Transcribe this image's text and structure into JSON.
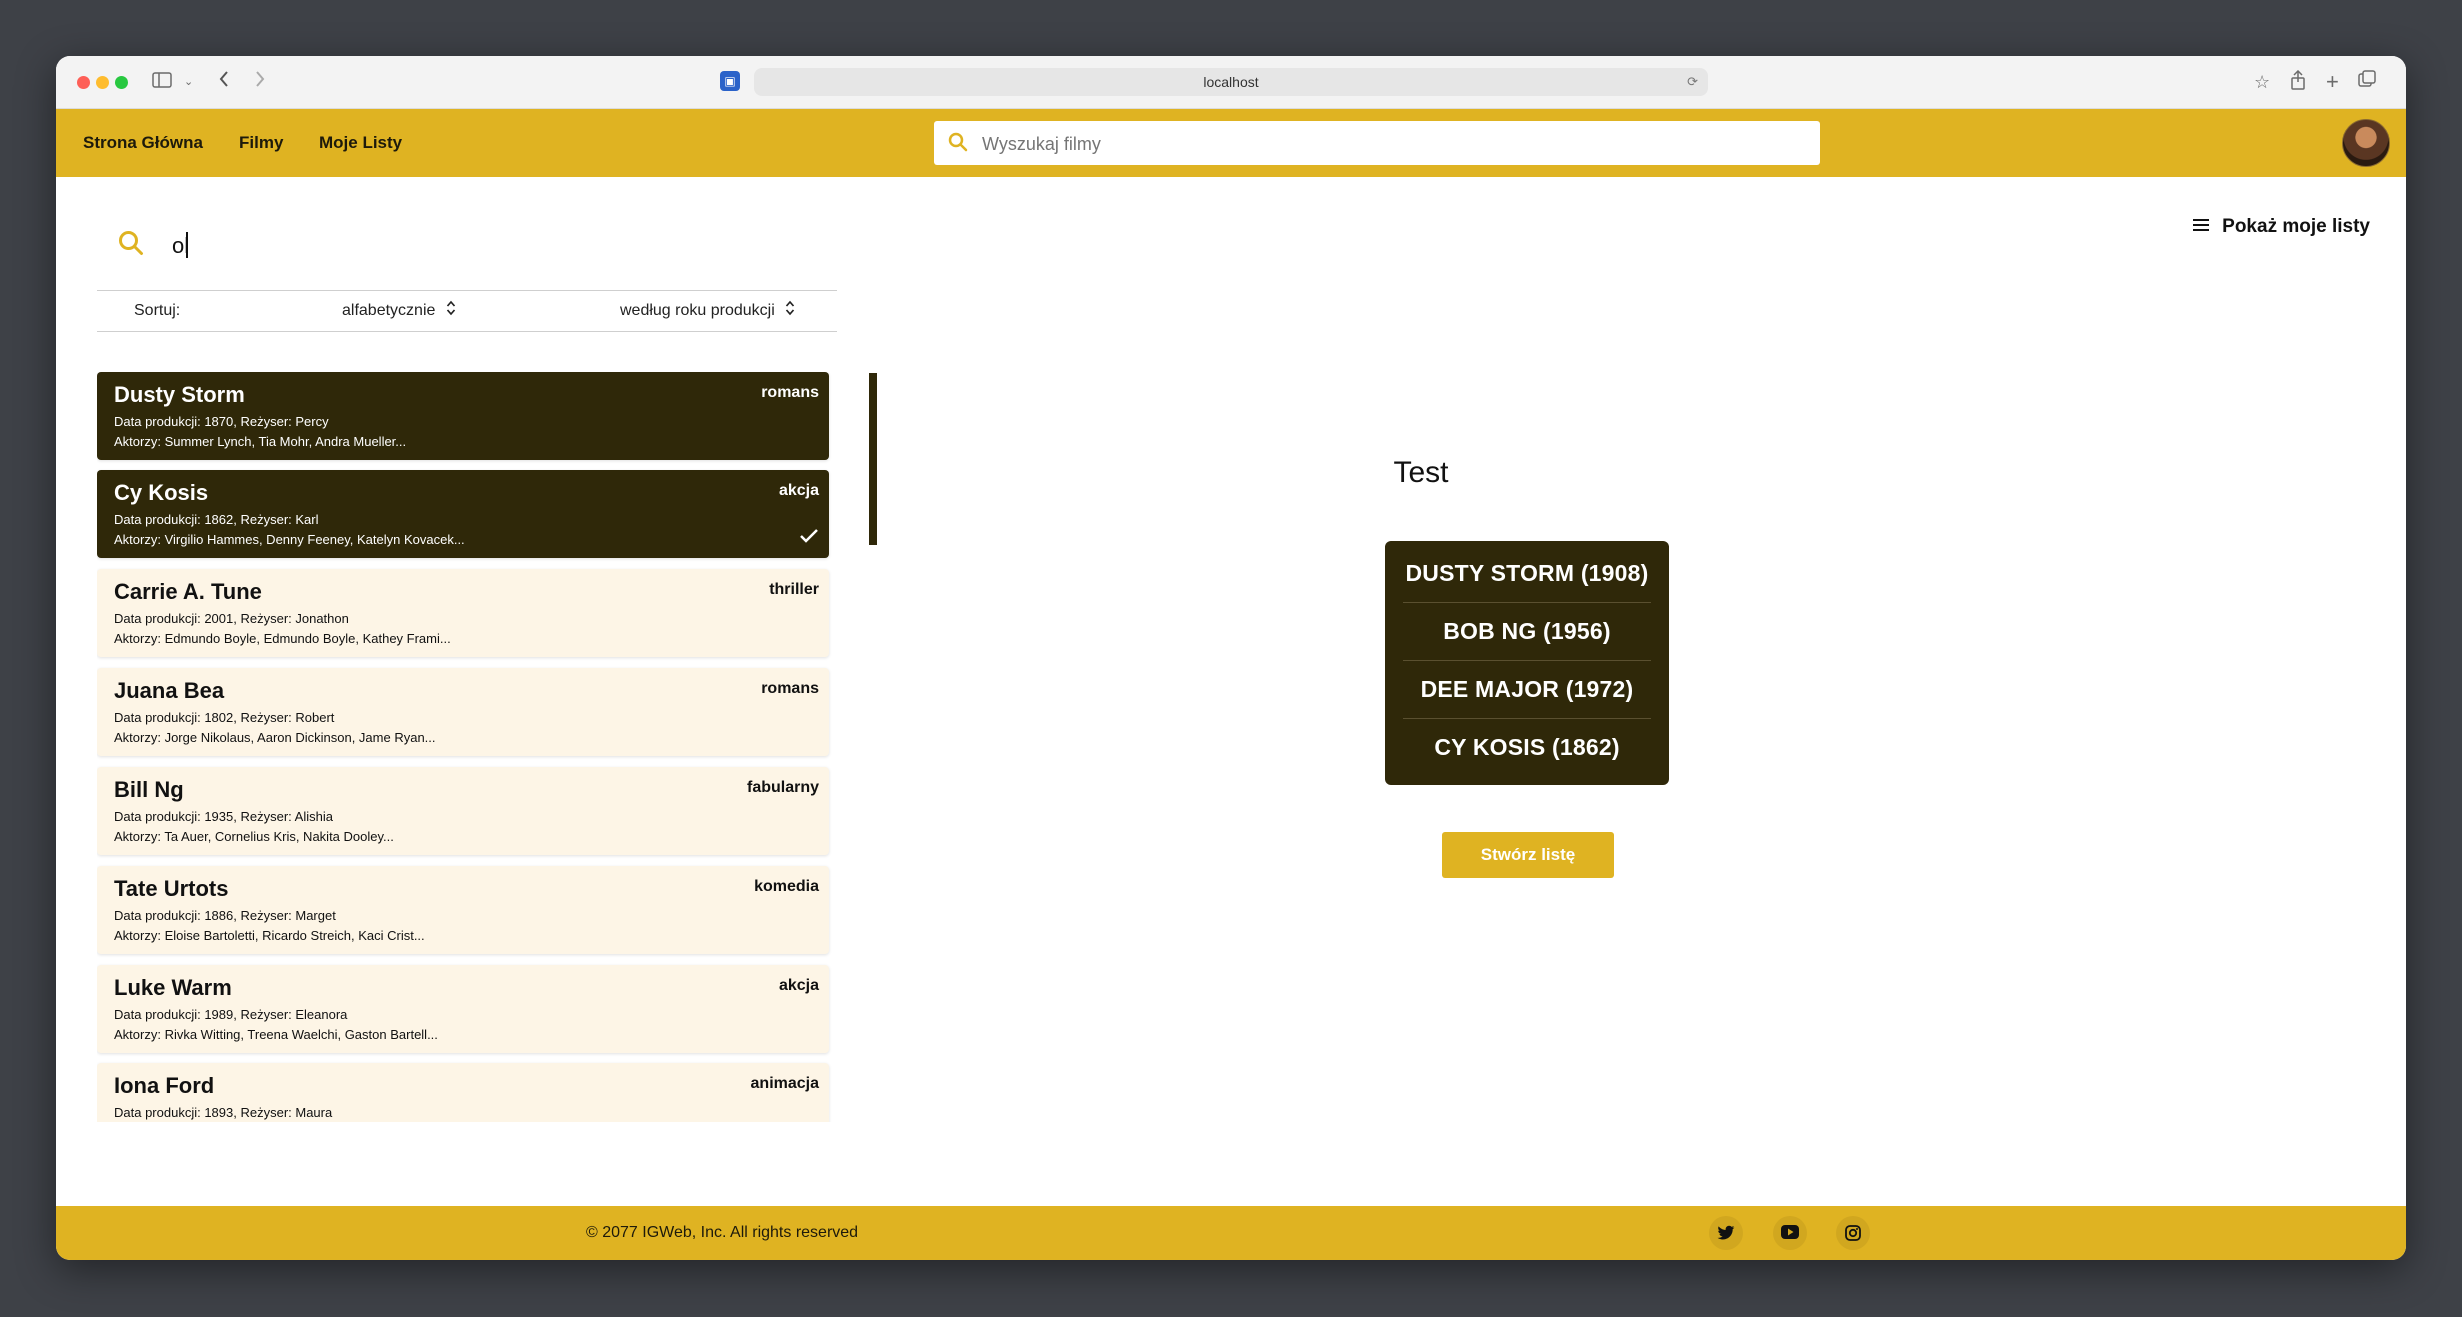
{
  "browser": {
    "url": "localhost"
  },
  "navbar": {
    "links": [
      "Strona Główna",
      "Filmy",
      "Moje Listy"
    ],
    "search_placeholder": "Wyszukaj filmy"
  },
  "search": {
    "value": "ol"
  },
  "sort": {
    "label": "Sortuj:",
    "options": [
      "alfabetycznie",
      "według roku produkcji"
    ]
  },
  "movies": [
    {
      "title": "Dusty Storm",
      "genre": "romans",
      "line1": "Data produkcji: 1870, Reżyser: Percy",
      "line2": "Aktorzy: Summer Lynch, Tia Mohr, Andra Mueller...",
      "selected": true,
      "checked": false
    },
    {
      "title": "Cy Kosis",
      "genre": "akcja",
      "line1": "Data produkcji: 1862, Reżyser: Karl",
      "line2": "Aktorzy: Virgilio Hammes, Denny Feeney, Katelyn Kovacek...",
      "selected": true,
      "checked": true
    },
    {
      "title": "Carrie A. Tune",
      "genre": "thriller",
      "line1": "Data produkcji: 2001, Reżyser: Jonathon",
      "line2": "Aktorzy: Edmundo Boyle, Edmundo Boyle, Kathey Frami...",
      "selected": false,
      "checked": false
    },
    {
      "title": "Juana Bea",
      "genre": "romans",
      "line1": "Data produkcji: 1802, Reżyser: Robert",
      "line2": "Aktorzy: Jorge Nikolaus, Aaron Dickinson, Jame Ryan...",
      "selected": false,
      "checked": false
    },
    {
      "title": "Bill Ng",
      "genre": "fabularny",
      "line1": "Data produkcji: 1935, Reżyser: Alishia",
      "line2": "Aktorzy: Ta Auer, Cornelius Kris, Nakita Dooley...",
      "selected": false,
      "checked": false
    },
    {
      "title": "Tate Urtots",
      "genre": "komedia",
      "line1": "Data produkcji: 1886, Reżyser: Marget",
      "line2": "Aktorzy: Eloise Bartoletti, Ricardo Streich, Kaci Crist...",
      "selected": false,
      "checked": false
    },
    {
      "title": "Luke Warm",
      "genre": "akcja",
      "line1": "Data produkcji: 1989, Reżyser: Eleanora",
      "line2": "Aktorzy: Rivka Witting, Treena Waelchi, Gaston Bartell...",
      "selected": false,
      "checked": false
    },
    {
      "title": "Iona Ford",
      "genre": "animacja",
      "line1": "Data produkcji: 1893, Reżyser: Maura",
      "line2": "",
      "selected": false,
      "checked": false
    }
  ],
  "right_panel": {
    "show_lists": "Pokaż moje listy",
    "list_title": "Test",
    "list_items": [
      "DUSTY STORM (1908)",
      "BOB NG (1956)",
      "DEE MAJOR (1972)",
      "CY KOSIS (1862)"
    ],
    "create_button": "Stwórz listę"
  },
  "footer": {
    "copyright": "© 2077 IGWeb, Inc. All rights reserved",
    "social_icons": [
      "twitter-icon",
      "youtube-icon",
      "instagram-icon"
    ]
  },
  "colors": {
    "accent": "#dfb322",
    "dark": "#2f2809",
    "card_light": "#fdf5e6"
  }
}
